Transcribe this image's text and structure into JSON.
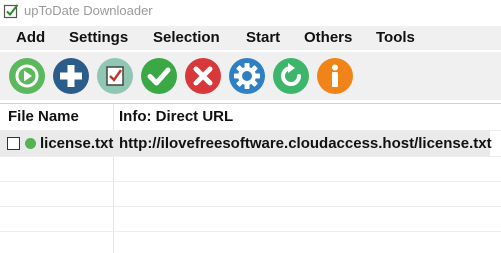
{
  "window": {
    "title": "upToDate Downloader"
  },
  "menu": [
    "Add",
    "Settings",
    "Selection",
    "Start",
    "Others",
    "Tools"
  ],
  "toolbar": [
    {
      "icon": "play-icon",
      "color": "#5cb85c"
    },
    {
      "icon": "plus-icon",
      "color": "#2b5d8a"
    },
    {
      "icon": "checklist-icon",
      "color": "#8fc7b3"
    },
    {
      "icon": "check-icon",
      "color": "#3aa845"
    },
    {
      "icon": "close-icon",
      "color": "#d9383a"
    },
    {
      "icon": "gear-icon",
      "color": "#2f7fc4"
    },
    {
      "icon": "refresh-icon",
      "color": "#3db56a"
    },
    {
      "icon": "info-icon",
      "color": "#f08418"
    }
  ],
  "list": {
    "columns": [
      "File Name",
      "Info: Direct URL"
    ],
    "rows": [
      {
        "checked": false,
        "status_color": "#59b055",
        "file_name": "license.txt",
        "url": "http://ilovefreesoftware.cloudaccess.host/license.txt"
      }
    ]
  }
}
